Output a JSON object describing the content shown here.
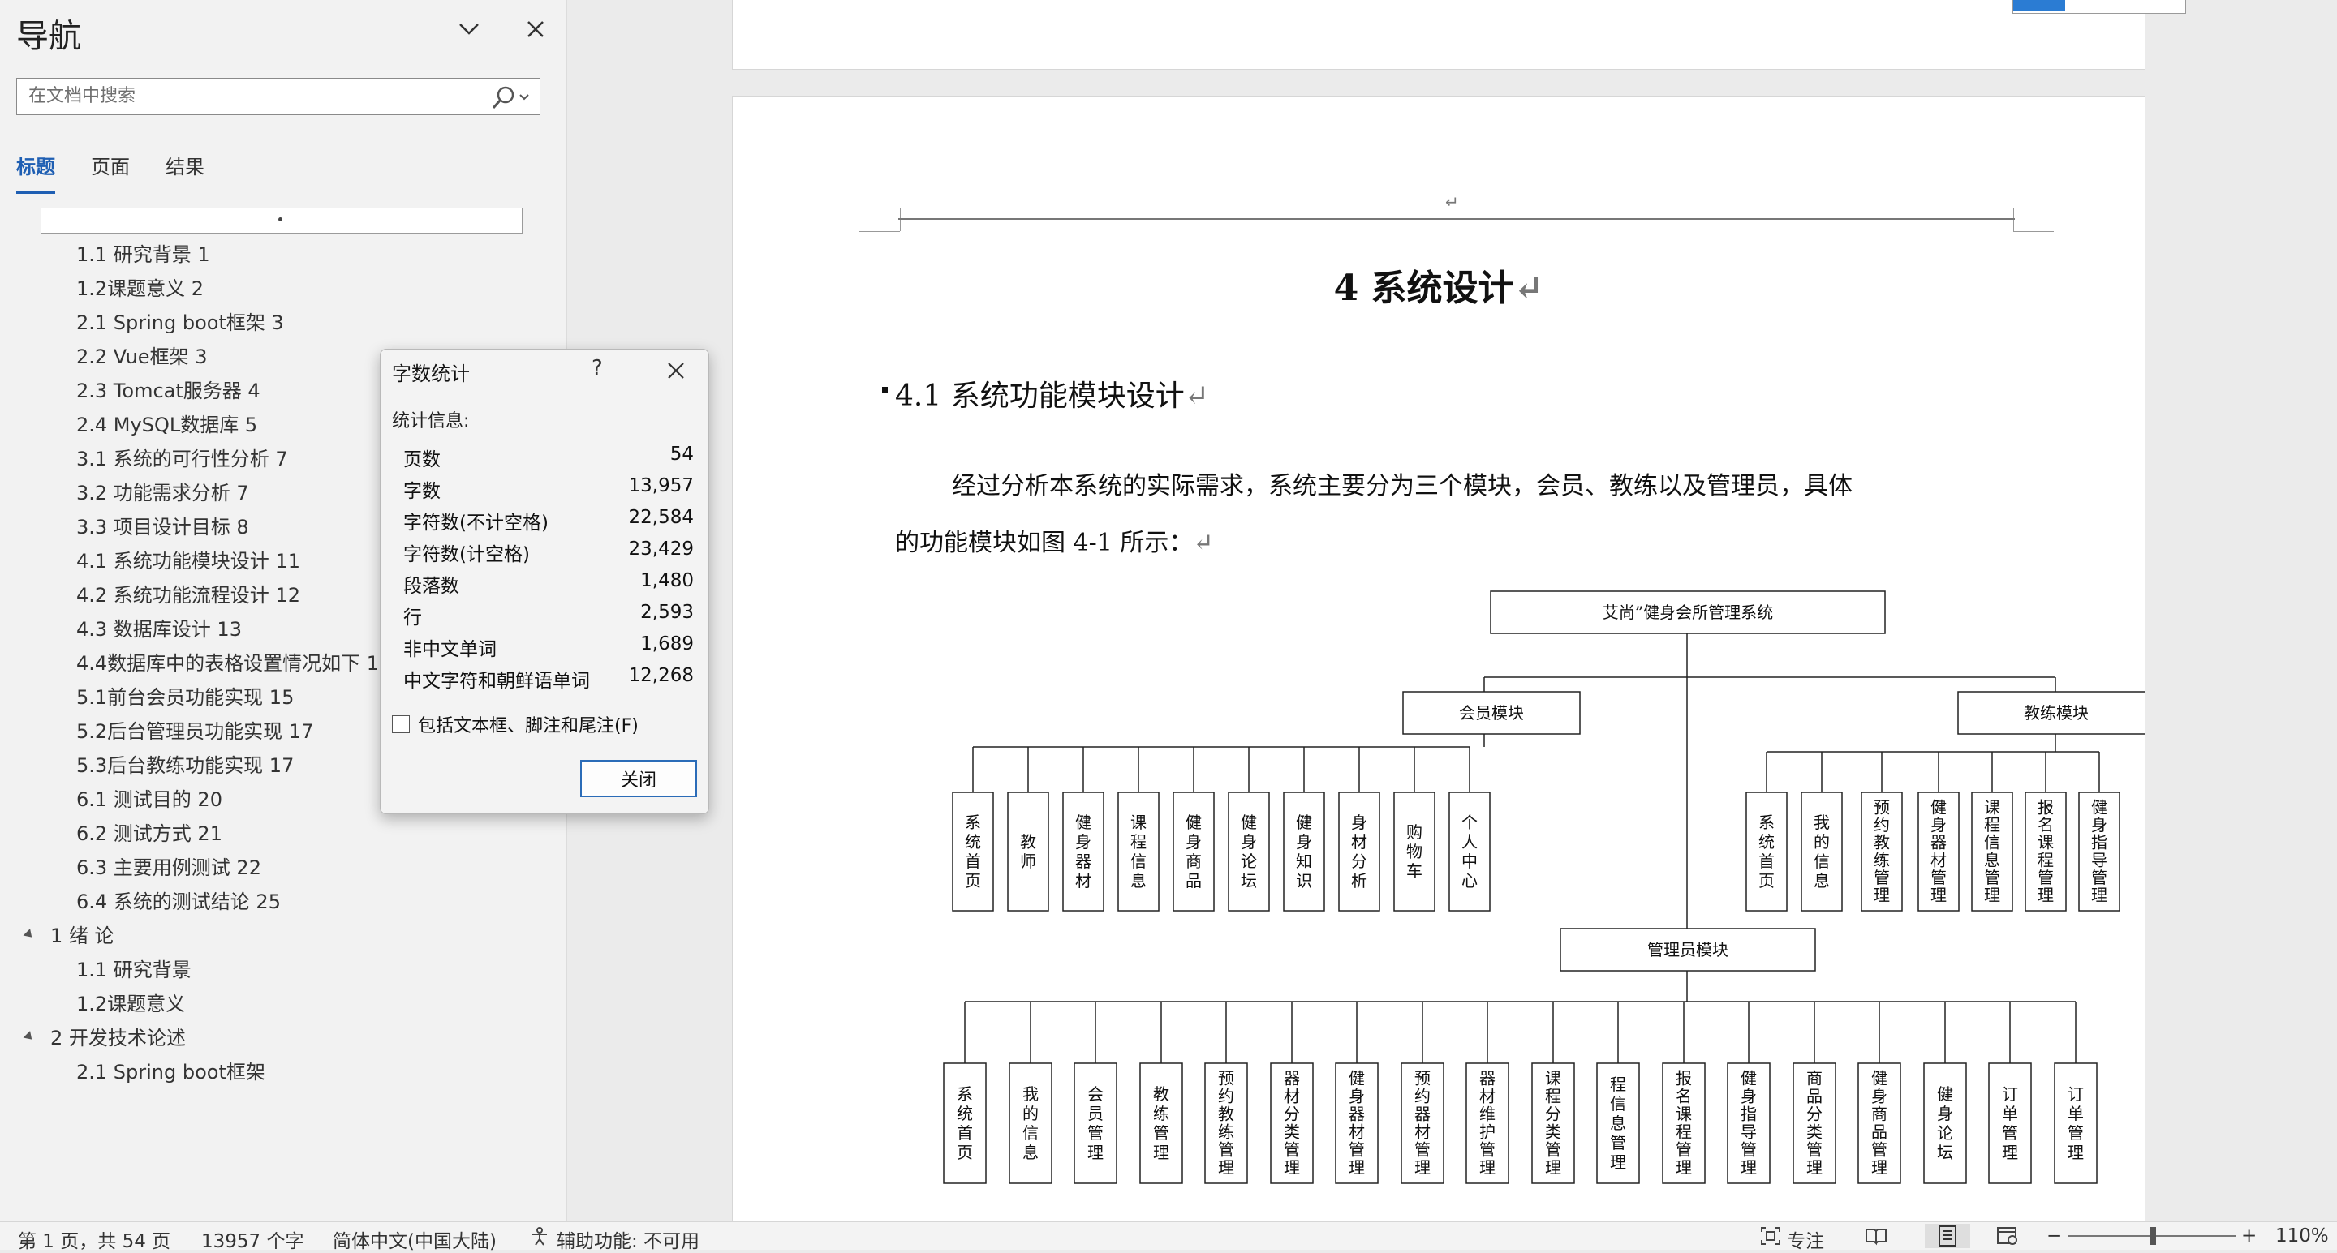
{
  "nav": {
    "title": "导航",
    "search_placeholder": "在文档中搜索",
    "tabs": [
      {
        "label": "标题",
        "active": true
      },
      {
        "label": "页面",
        "active": false
      },
      {
        "label": "结果",
        "active": false
      }
    ],
    "headings": [
      {
        "label": "1.1 研究背景 1",
        "level": 2
      },
      {
        "label": "1.2课题意义 2",
        "level": 2
      },
      {
        "label": "2.1 Spring boot框架 3",
        "level": 2
      },
      {
        "label": "2.2 Vue框架 3",
        "level": 2
      },
      {
        "label": "2.3 Tomcat服务器 4",
        "level": 2
      },
      {
        "label": "2.4 MySQL数据库 5",
        "level": 2
      },
      {
        "label": "3.1 系统的可行性分析 7",
        "level": 2
      },
      {
        "label": "3.2 功能需求分析 7",
        "level": 2
      },
      {
        "label": "3.3 项目设计目标 8",
        "level": 2
      },
      {
        "label": "4.1 系统功能模块设计 11",
        "level": 2
      },
      {
        "label": "4.2 系统功能流程设计  12",
        "level": 2
      },
      {
        "label": "4.3 数据库设计 13",
        "level": 2
      },
      {
        "label": "4.4数据库中的表格设置情况如下 13",
        "level": 2
      },
      {
        "label": "5.1前台会员功能实现 15",
        "level": 2
      },
      {
        "label": "5.2后台管理员功能实现 17",
        "level": 2
      },
      {
        "label": "5.3后台教练功能实现 17",
        "level": 2
      },
      {
        "label": "6.1  测试目的 20",
        "level": 2
      },
      {
        "label": "6.2  测试方式  21",
        "level": 2
      },
      {
        "label": "6.3 主要用例测试 22",
        "level": 2
      },
      {
        "label": "6.4 系统的测试结论 25",
        "level": 2
      },
      {
        "label": "1 绪 论",
        "level": 1
      },
      {
        "label": "1.1 研究背景",
        "level": 2
      },
      {
        "label": "1.2课题意义",
        "level": 2
      },
      {
        "label": "2 开发技术论述",
        "level": 1
      },
      {
        "label": "2.1 Spring boot框架",
        "level": 2
      }
    ]
  },
  "dialog": {
    "title": "字数统计",
    "help": "?",
    "section": "统计信息:",
    "stats": [
      {
        "label": "页数",
        "value": "54"
      },
      {
        "label": "字数",
        "value": "13,957"
      },
      {
        "label": "字符数(不计空格)",
        "value": "22,584"
      },
      {
        "label": "字符数(计空格)",
        "value": "23,429"
      },
      {
        "label": "段落数",
        "value": "1,480"
      },
      {
        "label": "行",
        "value": "2,593"
      },
      {
        "label": "非中文单词",
        "value": "1,689"
      },
      {
        "label": "中文字符和朝鲜语单词",
        "value": "12,268"
      }
    ],
    "checkbox_label": "包括文本框、脚注和尾注(F)",
    "close_label": "关闭"
  },
  "document": {
    "header_mark": "↵",
    "chapter_title": "4  系统设计",
    "section_title": "4.1  系统功能模块设计",
    "para_line1": "经过分析本系统的实际需求，系统主要分为三个模块，会员、教练以及管理员，具体",
    "para_line2": "的功能模块如图 4-1 所示：",
    "return_mark": "↵",
    "diagram": {
      "root": "艾尚”健身会所管理系统",
      "member_module": "会员模块",
      "coach_module": "教练模块",
      "admin_module": "管理员模块",
      "member_items": [
        "系统首页",
        "教师",
        "健身器材",
        "课程信息",
        "健身商品",
        "健身论坛",
        "健身知识",
        "身材分析",
        "购物车",
        "个人中心"
      ],
      "coach_items": [
        "系统首页",
        "我的信息",
        "预约教练管理",
        "健身器材管理",
        "课程信息管理",
        "报名课程管理",
        "健身指导管理"
      ],
      "admin_items": [
        "系统首页",
        "我的信息",
        "会员管理",
        "教练管理",
        "预约教练管理",
        "器材分类管理",
        "健身器材管理",
        "预约器材管理",
        "器材维护管理",
        "课程分类管理",
        "程信息管理",
        "报名课程管理",
        "健身指导管理",
        "商品分类管理",
        "健身商品管理",
        "健身论坛",
        "订单管理",
        "订单管理"
      ]
    }
  },
  "status": {
    "page_info": "第 1 页，共 54 页",
    "word_count": "13957 个字",
    "language": "简体中文(中国大陆)",
    "accessibility": "辅助功能: 不可用",
    "focus": "专注",
    "zoom": "110%",
    "zoom_minus": "−",
    "zoom_plus": "+"
  }
}
